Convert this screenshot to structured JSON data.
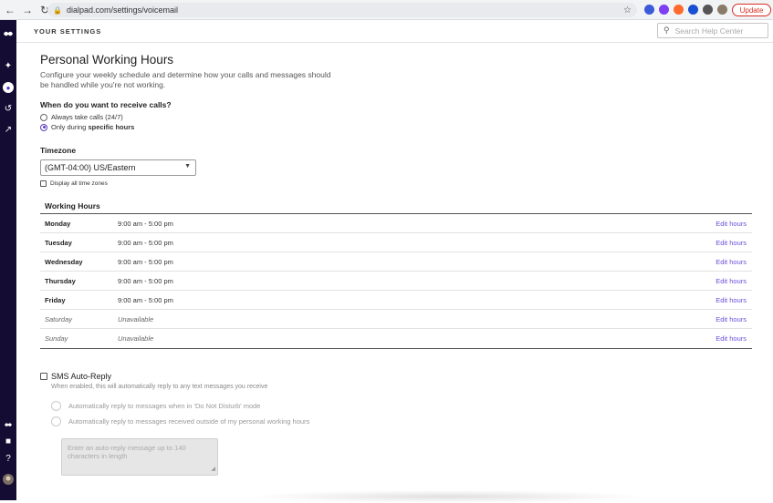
{
  "browser": {
    "url": "dialpad.com/settings/voicemail",
    "update_label": "Update"
  },
  "header": {
    "title": "YOUR SETTINGS",
    "search_placeholder": "Search Help Center"
  },
  "page": {
    "title": "Personal Working Hours",
    "description": "Configure your weekly schedule and determine how your calls and messages should be handled while you're not working.",
    "receive_question": "When do you want to receive calls?",
    "option_always": "Always take calls (24/7)",
    "option_specific_prefix": "Only during ",
    "option_specific_bold": "specific hours",
    "timezone_label": "Timezone",
    "timezone_value": "(GMT-04:00) US/Eastern",
    "display_all_tz": "Display all time zones",
    "working_hours_title": "Working Hours",
    "edit_label": "Edit hours"
  },
  "working_hours": [
    {
      "day": "Monday",
      "hours": "9:00 am - 5:00 pm",
      "off": false
    },
    {
      "day": "Tuesday",
      "hours": "9:00 am - 5:00 pm",
      "off": false
    },
    {
      "day": "Wednesday",
      "hours": "9:00 am - 5:00 pm",
      "off": false
    },
    {
      "day": "Thursday",
      "hours": "9:00 am - 5:00 pm",
      "off": false
    },
    {
      "day": "Friday",
      "hours": "9:00 am - 5:00 pm",
      "off": false
    },
    {
      "day": "Saturday",
      "hours": "Unavailable",
      "off": true
    },
    {
      "day": "Sunday",
      "hours": "Unavailable",
      "off": true
    }
  ],
  "sms": {
    "label": "SMS Auto-Reply",
    "description": "When enabled, this will automatically reply to any text messages you receive",
    "option_dnd": "Automatically reply to messages when in 'Do Not Disturb' mode",
    "option_outside": "Automatically reply to messages received outside of my personal working hours",
    "placeholder": "Enter an auto-reply message up to 140 characters in length"
  },
  "colors": {
    "accent": "#6b4fd8",
    "rail": "#150c33",
    "update": "#d93025"
  }
}
